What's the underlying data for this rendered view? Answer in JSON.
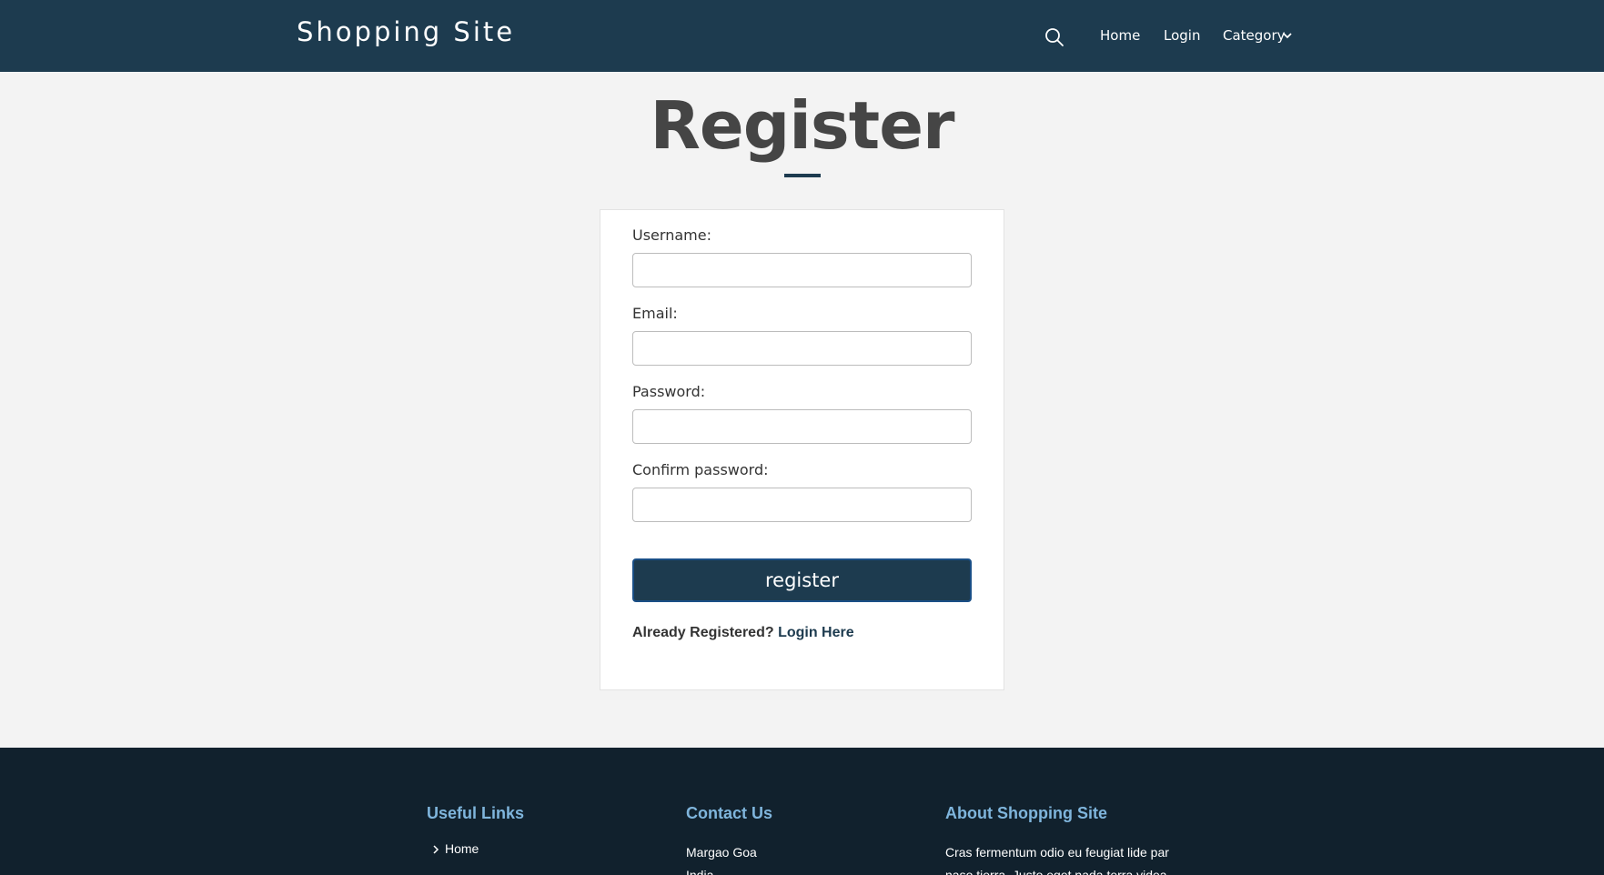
{
  "header": {
    "brand": "Shopping Site",
    "nav": {
      "home": "Home",
      "login": "Login",
      "category": "Category"
    }
  },
  "main": {
    "title": "Register",
    "form": {
      "username_label": "Username:",
      "email_label": "Email:",
      "password_label": "Password:",
      "confirm_label": "Confirm password:",
      "username_value": "",
      "email_value": "",
      "password_value": "",
      "confirm_value": "",
      "submit_label": "register",
      "already_text": "Already Registered?",
      "login_link": "Login Here"
    }
  },
  "footer": {
    "useful_links_heading": "Useful Links",
    "useful_links": [
      "Home"
    ],
    "contact_heading": "Contact Us",
    "contact_lines": [
      "Margao Goa",
      "India"
    ],
    "about_heading": "About Shopping Site",
    "about_lines": [
      "Cras fermentum odio eu feugiat lide par",
      "naso tierra. Justo eget nada terra videa"
    ]
  },
  "colors": {
    "header_bg": "#1d3b4f",
    "page_bg": "#f3f3f3",
    "footer_bg": "#11212d",
    "footer_heading": "#7fb5dc",
    "title_text": "#454545",
    "button_border": "#1a4f86"
  }
}
